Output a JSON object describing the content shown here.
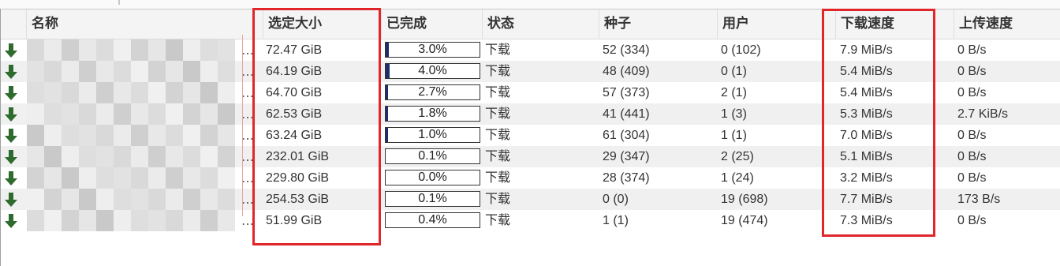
{
  "columns": {
    "name": "名称",
    "size": "选定大小",
    "done": "已完成",
    "status": "状态",
    "seeds": "种子",
    "peers": "用户",
    "down": "下载速度",
    "up": "上传速度"
  },
  "name_truncation": "…",
  "rows": [
    {
      "size": "72.47 GiB",
      "progress_label": "3.0%",
      "progress": 0.03,
      "status": "下载",
      "seeds": "52 (334)",
      "peers": "0 (102)",
      "down": "7.9 MiB/s",
      "up": "0 B/s"
    },
    {
      "size": "64.19 GiB",
      "progress_label": "4.0%",
      "progress": 0.04,
      "status": "下载",
      "seeds": "48 (409)",
      "peers": "0 (1)",
      "down": "5.4 MiB/s",
      "up": "0 B/s"
    },
    {
      "size": "64.70 GiB",
      "progress_label": "2.7%",
      "progress": 0.027,
      "status": "下载",
      "seeds": "57 (373)",
      "peers": "2 (1)",
      "down": "5.4 MiB/s",
      "up": "0 B/s"
    },
    {
      "size": "62.53 GiB",
      "progress_label": "1.8%",
      "progress": 0.018,
      "status": "下载",
      "seeds": "41 (441)",
      "peers": "1 (3)",
      "down": "5.3 MiB/s",
      "up": "2.7 KiB/s"
    },
    {
      "size": "63.24 GiB",
      "progress_label": "1.0%",
      "progress": 0.01,
      "status": "下载",
      "seeds": "61 (304)",
      "peers": "1 (1)",
      "down": "7.0 MiB/s",
      "up": "0 B/s"
    },
    {
      "size": "232.01 GiB",
      "progress_label": "0.1%",
      "progress": 0.001,
      "status": "下载",
      "seeds": "29 (347)",
      "peers": "2 (25)",
      "down": "5.1 MiB/s",
      "up": "0 B/s"
    },
    {
      "size": "229.80 GiB",
      "progress_label": "0.0%",
      "progress": 0.0,
      "status": "下载",
      "seeds": "28 (374)",
      "peers": "1 (24)",
      "down": "3.2 MiB/s",
      "up": "0 B/s"
    },
    {
      "size": "254.53 GiB",
      "progress_label": "0.1%",
      "progress": 0.001,
      "status": "下载",
      "seeds": "0 (0)",
      "peers": "19 (698)",
      "down": "7.7 MiB/s",
      "up": "173 B/s"
    },
    {
      "size": "51.99 GiB",
      "progress_label": "0.4%",
      "progress": 0.004,
      "status": "下载",
      "seeds": "1 (1)",
      "peers": "19 (474)",
      "down": "7.3 MiB/s",
      "up": "0 B/s"
    }
  ],
  "colors": {
    "download_arrow": "#2e6b2e",
    "progress_fill": "#1f2d6b",
    "highlight_box": "#e0262b"
  },
  "icons": {
    "status_icon": "download-arrow-icon"
  }
}
